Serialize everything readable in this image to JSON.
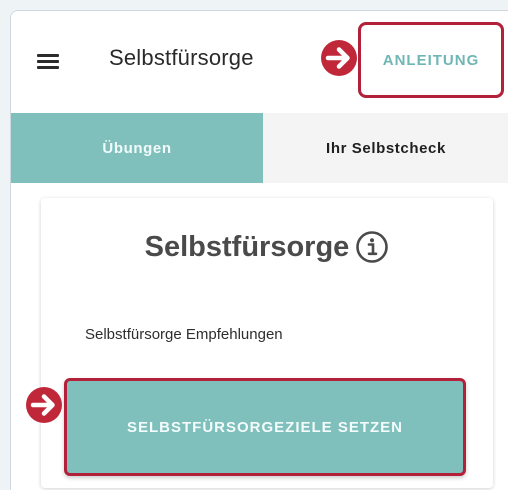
{
  "header": {
    "menu_icon": "hamburger-menu-icon",
    "title": "Selbstfürsorge",
    "guide_button_label": "ANLEITUNG"
  },
  "tabs": [
    {
      "label": "Übungen",
      "active": true
    },
    {
      "label": "Ihr Selbstcheck",
      "active": false
    }
  ],
  "card": {
    "title": "Selbstfürsorge",
    "info_icon": "info-circle-icon",
    "subtitle": "Selbstfürsorge Empfehlungen",
    "cta_label": "SELBSTFÜRSORGEZIELE SETZEN"
  },
  "annotations": {
    "marker_icon": "arrow-right-circle-icon"
  },
  "colors": {
    "accent": "#7fc0bd",
    "highlight": "#b3203a",
    "marker": "#c0283a"
  }
}
